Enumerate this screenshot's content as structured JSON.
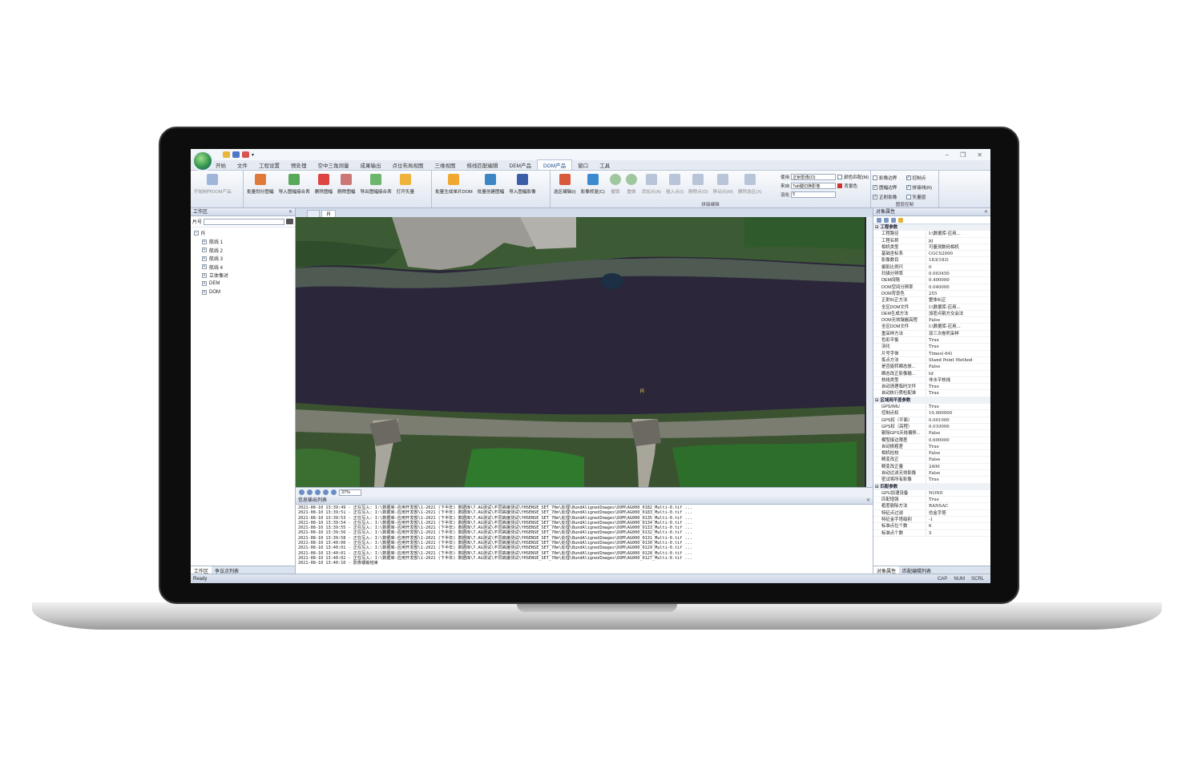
{
  "window": {
    "title_marker": "▾",
    "controls": [
      "−",
      "❐",
      "✕"
    ],
    "help": "❓"
  },
  "menu_tabs": [
    "开始",
    "文件",
    "工程设置",
    "预处理",
    "空中三角测量",
    "成果输出",
    "点位布局视图",
    "三维视图",
    "核线匹配编辑",
    "DEM产品",
    "DOM产品",
    "窗口",
    "工具"
  ],
  "active_tab": "DOM产品",
  "ribbon": {
    "group1": {
      "buttons": [
        "开始制作DOM产品"
      ]
    },
    "group2": {
      "buttons": [
        "批量划分图幅",
        "导入图幅接合表",
        "删除图幅",
        "删除图幅",
        "导出图幅接合表",
        "打开矢量"
      ]
    },
    "group3": {
      "buttons": [
        "批量生成单片DOM",
        "批量创建图幅",
        "导入图幅影像"
      ]
    },
    "group4": {
      "buttons": [
        "选区编辑(I)",
        "影像修复(C)",
        "撤销",
        "重做",
        "添加点(A)",
        "插入点(I)",
        "删除点(D)",
        "移动点(M)",
        "删除选区(X)"
      ],
      "opt_use": "使用",
      "opt_use_val": "正射影像(O)",
      "opt_src": "来自",
      "opt_src_val": "Tab键切换影像",
      "opt_feather": "羽化",
      "opt_feather_val": "5",
      "color_match": "颜色匹配(M)",
      "bgcolor": "背景色",
      "caption": "拼接编辑"
    },
    "group5": {
      "checks": [
        "影像边界",
        "控制点",
        "图幅边界",
        "拼接线(R)",
        "正射影像",
        "矢量层"
      ],
      "checked": [
        false,
        true,
        true,
        true,
        true,
        false
      ],
      "caption": "图层控制"
    }
  },
  "workspace": {
    "title": "工作区",
    "search_label": "片号",
    "root": "pj",
    "nodes": [
      "航线 1",
      "航线 2",
      "航线 3",
      "航线 4",
      "立体像对",
      "DEM",
      "DOM"
    ],
    "tabs": [
      "工作区",
      "争议点列表"
    ]
  },
  "docs": {
    "tabs": [
      "",
      "pj"
    ],
    "zoom": "37%",
    "map_label": "pj"
  },
  "log": {
    "title": "信息输出列表",
    "lines": [
      "2021-08-10 13:39:49 - 正在写入: I:\\数据库-应用开发部\\1-2021 (下半年) 数据库\\7.AG测试\\不同高度测试\\YHSENSE_SET_70m\\处理\\BundAlignedImages\\DOM\\AG000_0182_Multi-0.tif ...",
      "2021-08-10 13:39:51 - 正在写入: I:\\数据库-应用开发部\\1-2021 (下半年) 数据库\\7.AG测试\\不同高度测试\\YHSENSE_SET_70m\\处理\\BundAlignedImages\\DOM\\AG000_0183_Multi-0.tif ...",
      "2021-08-10 13:39:53 - 正在写入: I:\\数据库-应用开发部\\1-2021 (下半年) 数据库\\7.AG测试\\不同高度测试\\YHSENSE_SET_70m\\处理\\BundAlignedImages\\DOM\\AG000_0135_Multi-0.tif ...",
      "2021-08-10 13:39:54 - 正在写入: I:\\数据库-应用开发部\\1-2021 (下半年) 数据库\\7.AG测试\\不同高度测试\\YHSENSE_SET_70m\\处理\\BundAlignedImages\\DOM\\AG000_0134_Multi-0.tif ...",
      "2021-08-10 13:39:55 - 正在写入: I:\\数据库-应用开发部\\1-2021 (下半年) 数据库\\7.AG测试\\不同高度测试\\YHSENSE_SET_70m\\处理\\BundAlignedImages\\DOM\\AG000_0133_Multi-0.tif ...",
      "2021-08-10 13:39:56 - 正在写入: I:\\数据库-应用开发部\\1-2021 (下半年) 数据库\\7.AG测试\\不同高度测试\\YHSENSE_SET_70m\\处理\\BundAlignedImages\\DOM\\AG000_0132_Multi-0.tif ...",
      "2021-08-10 13:39:58 - 正在写入: I:\\数据库-应用开发部\\1-2021 (下半年) 数据库\\7.AG测试\\不同高度测试\\YHSENSE_SET_70m\\处理\\BundAlignedImages\\DOM\\AG000_0131_Multi-0.tif ...",
      "2021-08-10 13:40:00 - 正在写入: I:\\数据库-应用开发部\\1-2021 (下半年) 数据库\\7.AG测试\\不同高度测试\\YHSENSE_SET_70m\\处理\\BundAlignedImages\\DOM\\AG000_0130_Multi-0.tif ...",
      "2021-08-10 13:40:01 - 正在写入: I:\\数据库-应用开发部\\1-2021 (下半年) 数据库\\7.AG测试\\不同高度测试\\YHSENSE_SET_70m\\处理\\BundAlignedImages\\DOM\\AG000_0129_Multi-0.tif ...",
      "2021-08-10 13:40:01 - 正在写入: I:\\数据库-应用开发部\\1-2021 (下半年) 数据库\\7.AG测试\\不同高度测试\\YHSENSE_SET_70m\\处理\\BundAlignedImages\\DOM\\AG000_0128_Multi-0.tif ...",
      "2021-08-10 13:40:02 - 正在写入: I:\\数据库-应用开发部\\1-2021 (下半年) 数据库\\7.AG测试\\不同高度测试\\YHSENSE_SET_70m\\处理\\BundAlignedImages\\DOM\\AG000_0127_Multi-0.tif ...",
      "2021-08-10 13:40:10 - 影像镶嵌结束"
    ]
  },
  "properties": {
    "title": "对象属性",
    "tabs": [
      "对象属性",
      "匹配编辑列表"
    ],
    "sections": [
      {
        "name": "工程参数",
        "rows": [
          [
            "工程路径",
            "I:\\数据库-应用..."
          ],
          [
            "工程名称",
            "pj"
          ],
          [
            "相机类型",
            "可量测数码相机"
          ],
          [
            "基础坐标系",
            "CGCS2000"
          ],
          [
            "影像数目",
            "183(183)"
          ],
          [
            "摄影比例尺",
            "0"
          ],
          [
            "扫描分辨率",
            "0.003450"
          ],
          [
            "DEM间隔",
            "0.400000"
          ],
          [
            "DOM空间分辨率",
            "0.040000"
          ],
          [
            "DOM背景色",
            "255"
          ],
          [
            "正射纠正方法",
            "整体纠正"
          ],
          [
            "全区DOM文件",
            "I:\\数据库-应用..."
          ],
          [
            "DEM生成方法",
            "加密点剔方交会法"
          ],
          [
            "DOM无效镶嵌高程",
            "False"
          ],
          [
            "全区DOM文件",
            "I:\\数据库-应用..."
          ],
          [
            "重采样方法",
            "双三次卷积采样"
          ],
          [
            "色彩平衡",
            "True"
          ],
          [
            "羽化",
            "True"
          ],
          [
            "片号字体",
            "Times(-64)"
          ],
          [
            "拣点方法",
            "Stand Point Method"
          ],
          [
            "是否旋转瞬态放...",
            "False"
          ],
          [
            "瞬态改正影像输...",
            "tif"
          ],
          [
            "核线类型",
            "非水平核线"
          ],
          [
            "自动清理临时文件",
            "True"
          ],
          [
            "自动执行质检配准",
            "True"
          ]
        ]
      },
      {
        "name": "区域网平差参数",
        "rows": [
          [
            "GPS/IMU",
            "True"
          ],
          [
            "控制点权",
            "10.000000"
          ],
          [
            "GPS权（平面）",
            "0.001000"
          ],
          [
            "GPS权（高程）",
            "0.010000"
          ],
          [
            "剔除GPS天线偏移...",
            "False"
          ],
          [
            "模型接边限差",
            "0.600000"
          ],
          [
            "自动挑粗差",
            "True"
          ],
          [
            "相机检校",
            "False"
          ],
          [
            "畸变改正",
            "False"
          ],
          [
            "畸变改正量",
            "2400"
          ],
          [
            "自动过滤无效影像",
            "False"
          ],
          [
            "密试将所有影像",
            "True"
          ]
        ]
      },
      {
        "name": "匹配参数",
        "rows": [
          [
            "GPU加速设备",
            "NONE"
          ],
          [
            "匹配增强",
            "True"
          ],
          [
            "粗差剔除方法",
            "RANSAC"
          ],
          [
            "特征点过滤",
            "仿金字塔"
          ],
          [
            "特征金字塔级别",
            "-1"
          ],
          [
            "标准点位个数",
            "6"
          ],
          [
            "标准点个数",
            "5"
          ]
        ]
      }
    ]
  },
  "status": {
    "left": "Ready",
    "cap": "CAP",
    "num": "NUM",
    "scrl": "SCRL"
  }
}
